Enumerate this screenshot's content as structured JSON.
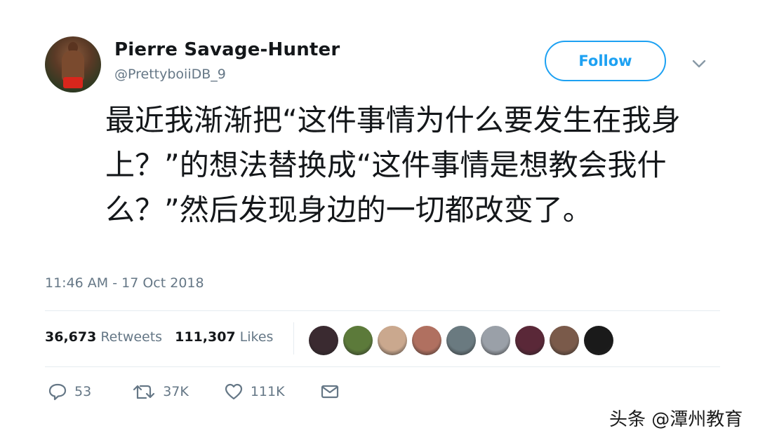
{
  "tweet": {
    "author_name": "Pierre Savage-Hunter",
    "author_handle": "@PrettyboiiDB_9",
    "follow_label": "Follow",
    "text": "最近我渐渐把“这件事情为什么要发生在我身上？”的想法替换成“这件事情是想教会我什么？”然后发现身边的一切都改变了。",
    "timestamp": "11:46 AM - 17 Oct 2018",
    "stats": {
      "retweets_count": "36,673",
      "retweets_label": "Retweets",
      "likes_count": "111,307",
      "likes_label": "Likes"
    },
    "likers_colors": [
      "#3a2a30",
      "#5c7a3a",
      "#caa88e",
      "#b07060",
      "#6a7a80",
      "#9aa0a8",
      "#5a2838",
      "#7a5a4a",
      "#1a1a1a"
    ],
    "actions": {
      "reply_count": "53",
      "retweet_count": "37K",
      "like_count": "111K"
    }
  },
  "watermark": "头条 @潭州教育",
  "colors": {
    "accent": "#1da1f2",
    "secondary_text": "#657786",
    "primary_text": "#14171a"
  }
}
